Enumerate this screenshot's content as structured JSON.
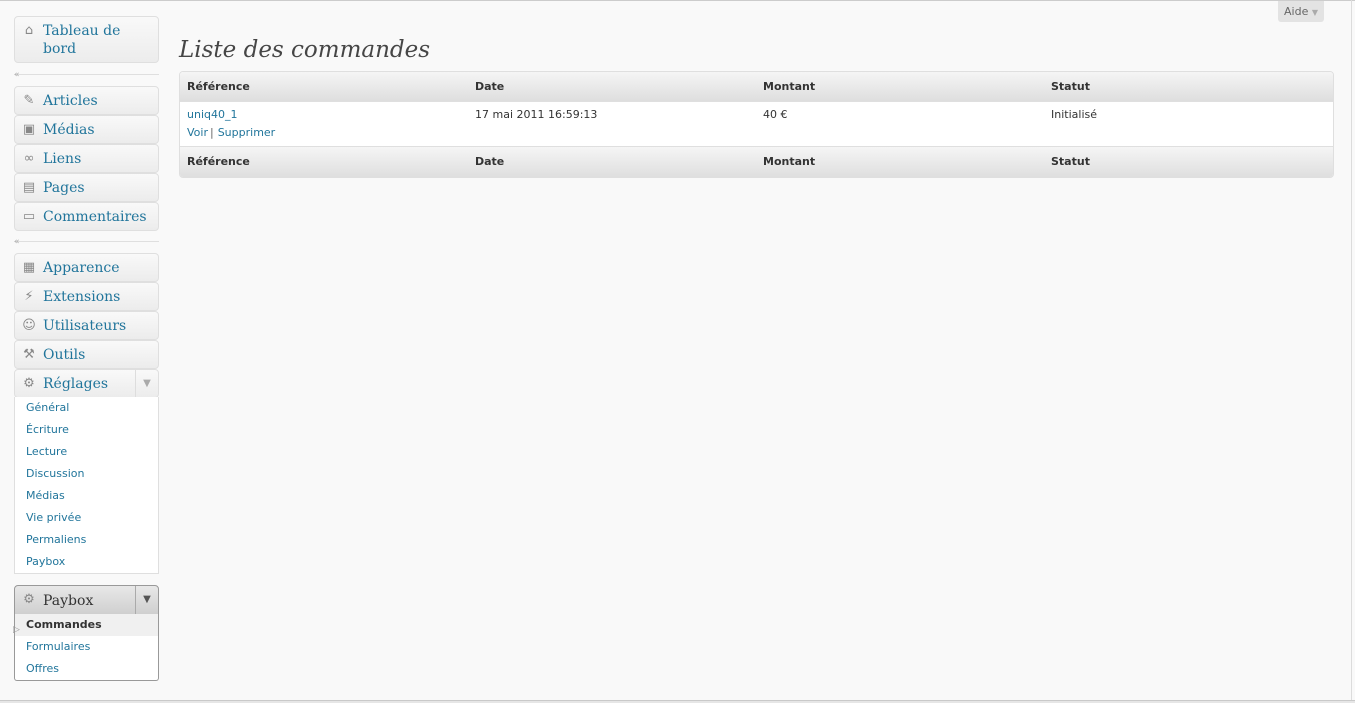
{
  "help": {
    "label": "Aide"
  },
  "sidebar": {
    "dashboard": "Tableau de bord",
    "group1": [
      "Articles",
      "Médias",
      "Liens",
      "Pages",
      "Commentaires"
    ],
    "group2": [
      "Apparence",
      "Extensions",
      "Utilisateurs",
      "Outils",
      "Réglages"
    ],
    "settings_sub": [
      "Général",
      "Écriture",
      "Lecture",
      "Discussion",
      "Médias",
      "Vie privée",
      "Permaliens",
      "Paybox"
    ],
    "paybox": {
      "label": "Paybox",
      "sub": [
        "Commandes",
        "Formulaires",
        "Offres"
      ]
    }
  },
  "main": {
    "title": "Liste des commandes",
    "columns": [
      "Référence",
      "Date",
      "Montant",
      "Statut"
    ],
    "rows": [
      {
        "reference": "uniq40_1",
        "date": "17 mai 2011 16:59:13",
        "montant": "40 €",
        "statut": "Initialisé",
        "actions": [
          "Voir",
          "Supprimer"
        ]
      }
    ]
  }
}
